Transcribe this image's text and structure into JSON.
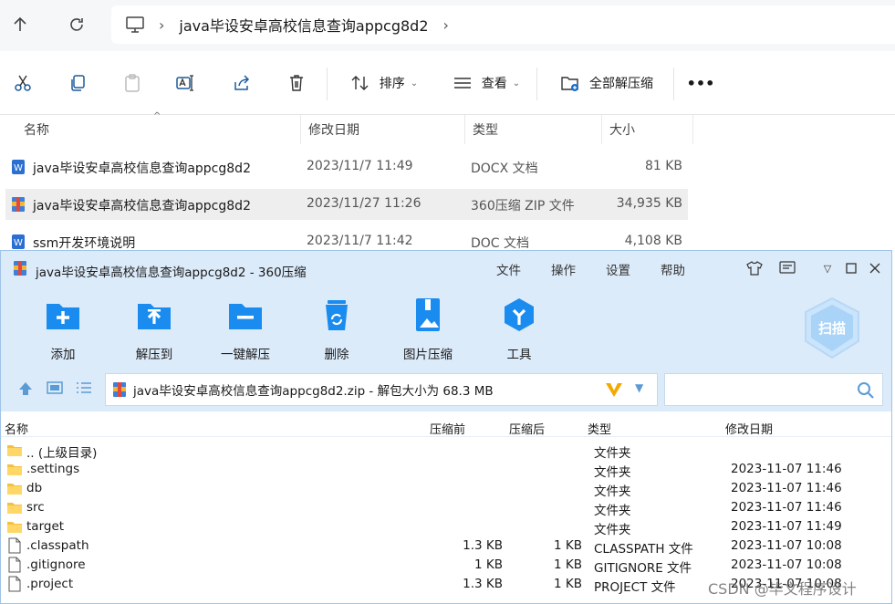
{
  "explorer": {
    "breadcrumb": "java毕设安卓高校信息查询appcg8d2",
    "toolbar": {
      "sort_label": "排序",
      "view_label": "查看",
      "extract_all_label": "全部解压缩",
      "more_label": "•••"
    },
    "columns": {
      "name": "名称",
      "modified": "修改日期",
      "type": "类型",
      "size": "大小"
    },
    "files": [
      {
        "name": "java毕设安卓高校信息查询appcg8d2",
        "modified": "2023/11/7 11:49",
        "type": "DOCX 文档",
        "size": "81 KB",
        "icon": "word-doc-icon"
      },
      {
        "name": "java毕设安卓高校信息查询appcg8d2",
        "modified": "2023/11/27 11:26",
        "type": "360压缩 ZIP 文件",
        "size": "34,935 KB",
        "icon": "zip-archive-icon"
      },
      {
        "name": "ssm开发环境说明",
        "modified": "2023/11/7 11:42",
        "type": "DOC 文档",
        "size": "4,108 KB",
        "icon": "word-doc-icon"
      }
    ]
  },
  "zip": {
    "title": "java毕设安卓高校信息查询appcg8d2 - 360压缩",
    "menu": [
      "文件",
      "操作",
      "设置",
      "帮助"
    ],
    "tools": [
      {
        "label": "添加",
        "icon": "add-folder-icon"
      },
      {
        "label": "解压到",
        "icon": "extract-to-icon"
      },
      {
        "label": "一键解压",
        "icon": "one-click-extract-icon"
      },
      {
        "label": "删除",
        "icon": "recycle-bin-icon"
      },
      {
        "label": "图片压缩",
        "icon": "image-compress-icon"
      },
      {
        "label": "工具",
        "icon": "tools-icon"
      }
    ],
    "scan_label": "扫描",
    "path": "java毕设安卓高校信息查询appcg8d2.zip - 解包大小为 68.3 MB",
    "columns": {
      "name": "名称",
      "before": "压缩前",
      "after": "压缩后",
      "type": "类型",
      "modified": "修改日期"
    },
    "rows": [
      {
        "name": ".. (上级目录)",
        "before": "",
        "after": "",
        "type": "文件夹",
        "modified": "",
        "kind": "folder"
      },
      {
        "name": ".settings",
        "before": "",
        "after": "",
        "type": "文件夹",
        "modified": "2023-11-07 11:46",
        "kind": "folder"
      },
      {
        "name": "db",
        "before": "",
        "after": "",
        "type": "文件夹",
        "modified": "2023-11-07 11:46",
        "kind": "folder"
      },
      {
        "name": "src",
        "before": "",
        "after": "",
        "type": "文件夹",
        "modified": "2023-11-07 11:46",
        "kind": "folder"
      },
      {
        "name": "target",
        "before": "",
        "after": "",
        "type": "文件夹",
        "modified": "2023-11-07 11:49",
        "kind": "folder"
      },
      {
        "name": ".classpath",
        "before": "1.3 KB",
        "after": "1 KB",
        "type": "CLASSPATH 文件",
        "modified": "2023-11-07 10:08",
        "kind": "file"
      },
      {
        "name": ".gitignore",
        "before": "1 KB",
        "after": "1 KB",
        "type": "GITIGNORE 文件",
        "modified": "2023-11-07 10:08",
        "kind": "file"
      },
      {
        "name": ".project",
        "before": "1.3 KB",
        "after": "1 KB",
        "type": "PROJECT 文件",
        "modified": "2023-11-07 10:08",
        "kind": "file"
      }
    ]
  },
  "watermark": "CSDN @毕文程序设计",
  "colors": {
    "accent_blue": "#1a8cf0",
    "title_bg": "#dcebfa",
    "folder": "#f5c042"
  }
}
